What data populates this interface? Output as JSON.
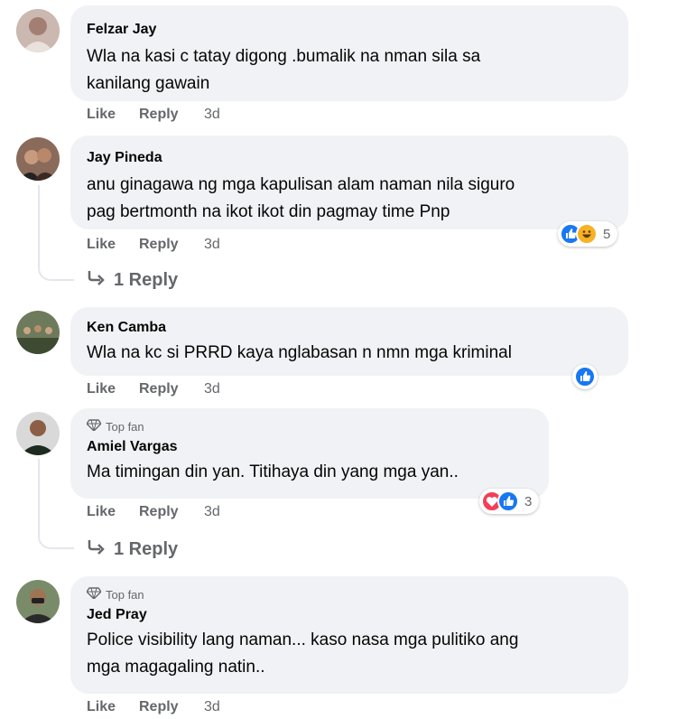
{
  "comments": [
    {
      "author": "Felzar Jay",
      "text_lines": [
        "Wla na kasi c tatay digong .bumalik na nman sila sa",
        "kanilang gawain"
      ],
      "like": "Like",
      "reply": "Reply",
      "time": "3d"
    },
    {
      "author": "Jay Pineda",
      "text_lines": [
        "anu ginagawa ng mga kapulisan alam naman nila siguro",
        "pag bertmonth na ikot ikot din pagmay time Pnp"
      ],
      "like": "Like",
      "reply": "Reply",
      "time": "3d",
      "reaction_count": "5",
      "view_replies": "1 Reply"
    },
    {
      "author": "Ken Camba",
      "text_lines": [
        "Wla na kc si PRRD kaya nglabasan n nmn mga kriminal"
      ],
      "like": "Like",
      "reply": "Reply",
      "time": "3d"
    },
    {
      "badge": "Top fan",
      "author": "Amiel Vargas",
      "text_lines": [
        "Ma timingan din yan. Titihaya din yang mga yan.."
      ],
      "like": "Like",
      "reply": "Reply",
      "time": "3d",
      "reaction_count": "3",
      "view_replies": "1 Reply"
    },
    {
      "badge": "Top fan",
      "author": "Jed Pray",
      "text_lines": [
        "Police visibility lang naman... kaso nasa mga pulitiko ang",
        "mga magagaling natin.."
      ],
      "like": "Like",
      "reply": "Reply",
      "time": "3d"
    }
  ],
  "colors": {
    "bubble": "#f0f2f5",
    "meta": "#65676b",
    "like_reaction": "#1877f2",
    "haha_reaction": "#f7b125",
    "love_reaction": "#f33e58"
  },
  "icons": [
    "diamond-icon",
    "reply-arrow-icon",
    "like-reaction-icon",
    "haha-reaction-icon",
    "love-reaction-icon"
  ]
}
